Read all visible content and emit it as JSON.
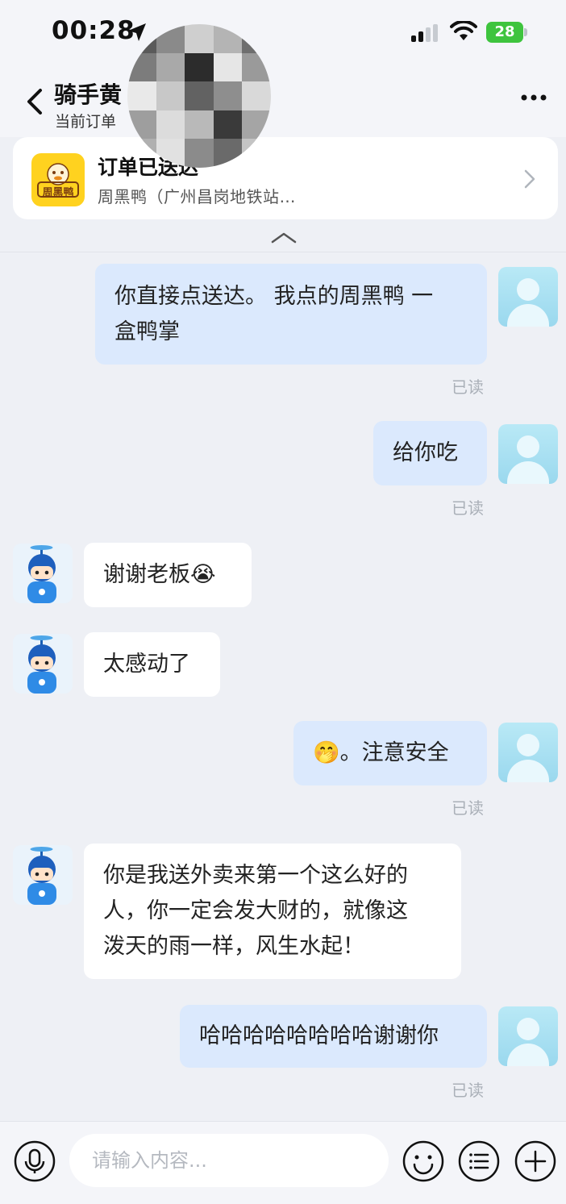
{
  "status_bar": {
    "time": "00:28",
    "battery": "28"
  },
  "header": {
    "title": "骑手黄",
    "subtitle": "当前订单"
  },
  "order_card": {
    "status": "订单已送达",
    "store": "周黑鸭（广州昌岗地铁站…",
    "logo_text": "周黑鸭"
  },
  "messages": [
    {
      "side": "out",
      "lines": [
        "你直接点送达。 我点的周黑鸭 一",
        "盒鸭掌"
      ],
      "read": "已读"
    },
    {
      "side": "out",
      "lines": [
        "给你吃"
      ],
      "read": "已读"
    },
    {
      "side": "in",
      "lines": [
        "谢谢老板😭"
      ]
    },
    {
      "side": "in",
      "lines": [
        "太感动了"
      ]
    },
    {
      "side": "out",
      "lines": [
        "🤭。注意安全"
      ],
      "read": "已读"
    },
    {
      "side": "in",
      "lines": [
        "你是我送外卖来第一个这么好的",
        "人，你一定会发大财的，就像这",
        "泼天的雨一样，风生水起！"
      ]
    },
    {
      "side": "out",
      "lines": [
        "哈哈哈哈哈哈哈哈谢谢你"
      ],
      "read": "已读"
    }
  ],
  "input": {
    "placeholder": "请输入内容..."
  },
  "icons": {
    "back": "back-icon",
    "more": "more-icon",
    "voice": "voice-icon",
    "emoji": "emoji-icon",
    "quick_reply": "quick-reply-icon",
    "plus": "plus-icon"
  },
  "colors": {
    "page_bg": "#eef0f5",
    "outgoing_bubble": "#dbe9fd",
    "incoming_bubble": "#ffffff",
    "battery_green": "#3ec43e",
    "logo_yellow": "#ffd21f"
  }
}
